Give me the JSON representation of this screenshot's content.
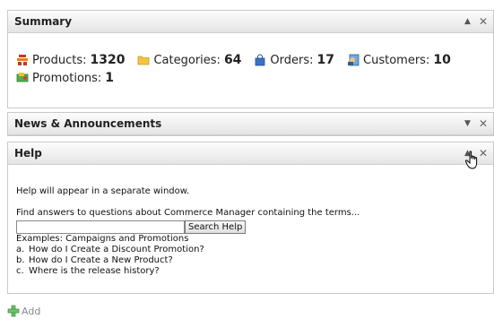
{
  "summary": {
    "title": "Summary",
    "stats": [
      {
        "label": "Products:",
        "value": "1320",
        "icon": "products-icon"
      },
      {
        "label": "Categories:",
        "value": "64",
        "icon": "folder-icon"
      },
      {
        "label": "Orders:",
        "value": "17",
        "icon": "shopping-bag-icon"
      },
      {
        "label": "Customers:",
        "value": "10",
        "icon": "customers-icon"
      },
      {
        "label": "Promotions:",
        "value": "1",
        "icon": "promotions-icon"
      }
    ]
  },
  "news": {
    "title": "News & Announcements"
  },
  "help": {
    "title": "Help",
    "intro": "Help will appear in a separate window.",
    "find_text": "Find answers to questions about Commerce Manager containing the terms...",
    "search_value": "",
    "search_button": "Search Help",
    "examples_label": "Examples: Campaigns and Promotions",
    "faqs": [
      {
        "mark": "a.",
        "text": "How do I Create a Discount Promotion?"
      },
      {
        "mark": "b.",
        "text": "How do I Create a New Product?"
      },
      {
        "mark": "c.",
        "text": "Where is the release history?"
      }
    ]
  },
  "add": {
    "label": "Add"
  },
  "colors": {
    "header_bg": "#e4e4e4",
    "add_green": "#5cb85c"
  }
}
